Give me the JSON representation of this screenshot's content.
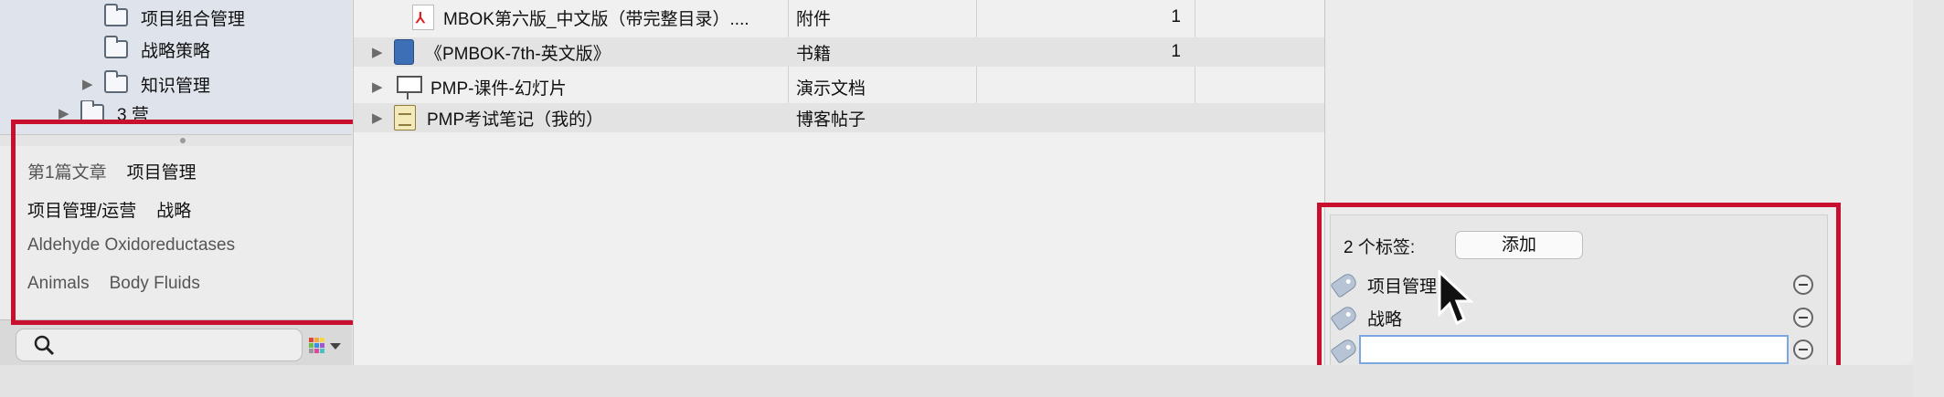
{
  "sidebar": {
    "tree": [
      {
        "label": "项目组合管理",
        "expandable": false
      },
      {
        "label": "战略策略",
        "expandable": false
      },
      {
        "label": "知识管理",
        "expandable": true
      },
      {
        "label": "3 营",
        "expandable": true
      }
    ],
    "tag_cloud": {
      "row1": [
        "第1篇文章",
        "项目管理"
      ],
      "row2": [
        "项目管理/运营",
        "战略"
      ],
      "row3": [
        "Aldehyde Oxidoreductases"
      ],
      "row4": [
        "Animals",
        "Body Fluids"
      ]
    },
    "search": {
      "placeholder": ""
    }
  },
  "documents": [
    {
      "name": "MBOK第六版_中文版（带完整目录）....",
      "kind": "附件",
      "count": "1",
      "icon": "pdf-icon",
      "expandable": false
    },
    {
      "name": "《PMBOK-7th-英文版》",
      "kind": "书籍",
      "count": "1",
      "icon": "book-icon",
      "expandable": true
    },
    {
      "name": "PMP-课件-幻灯片",
      "kind": "演示文档",
      "count": "",
      "icon": "presentation-icon",
      "expandable": true
    },
    {
      "name": "PMP考试笔记（我的）",
      "kind": "博客帖子",
      "count": "",
      "icon": "note-icon",
      "expandable": true
    }
  ],
  "tags_panel": {
    "count_label": "2 个标签:",
    "add_label": "添加",
    "tags": [
      "项目管理",
      "战略"
    ],
    "new_tag_value": ""
  },
  "colors": {
    "highlight_box": "#c8102e",
    "input_focus": "#7aa7e0"
  }
}
